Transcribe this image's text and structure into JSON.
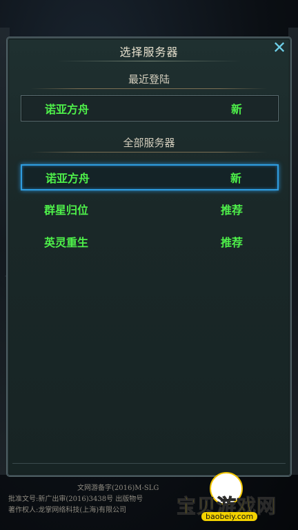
{
  "dialog": {
    "title": "选择服务器",
    "close_symbol": "✕",
    "recent_label": "最近登陆",
    "all_label": "全部服务器"
  },
  "recent_server": {
    "name": "诺亚方舟",
    "tag": "新"
  },
  "all_servers": [
    {
      "name": "诺亚方舟",
      "tag": "新"
    },
    {
      "name": "群星归位",
      "tag": "推荐"
    },
    {
      "name": "英灵重生",
      "tag": "推荐"
    }
  ],
  "footer": {
    "line1": "文网游备字(2016)M-SLG",
    "line2": "批准文号:新广出审(2016)3438号   出版物号",
    "line3": "著作权人:龙掌网络科技(上海)有限公司"
  },
  "watermark": {
    "text": "宝贝游戏网",
    "url": "baobeiy.com"
  },
  "colors": {
    "server_green": "#4ef04a",
    "selected_border": "#2f9de0",
    "close_cyan": "#6ecfe8"
  }
}
